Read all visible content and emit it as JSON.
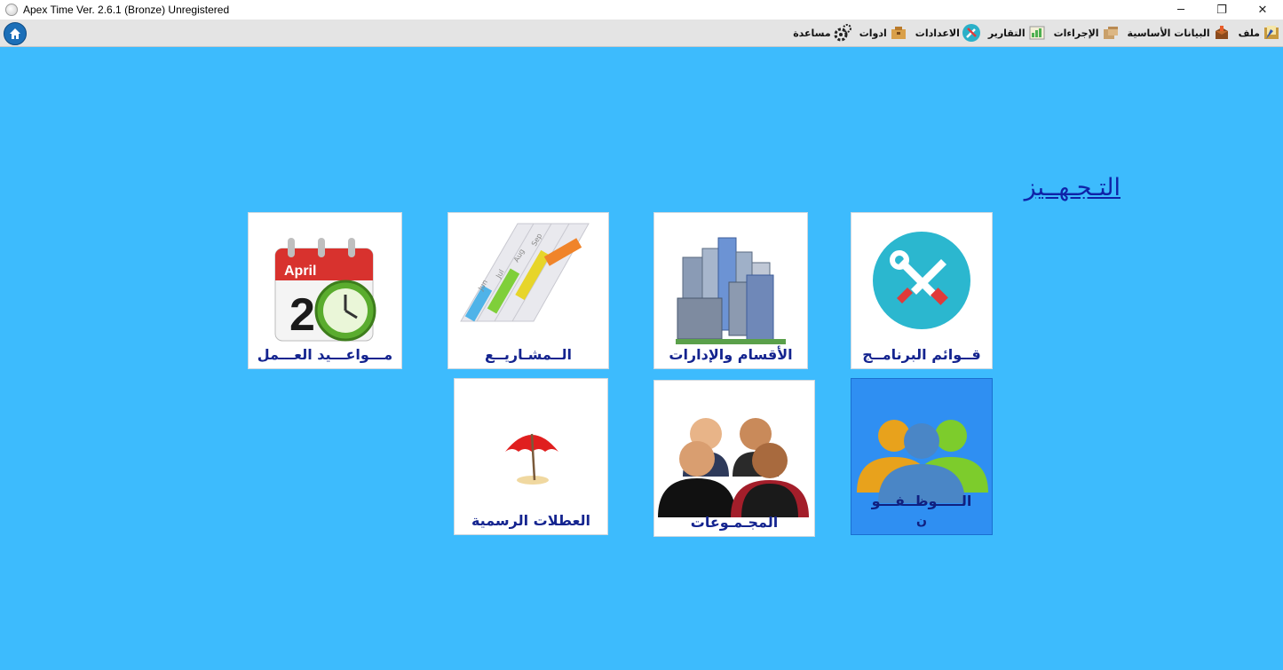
{
  "window": {
    "title": "Apex Time Ver. 2.6.1 (Bronze) Unregistered",
    "minimize": "─",
    "restore": "❐",
    "close": "✕"
  },
  "menu": {
    "items": [
      {
        "label": "ملف",
        "icon": "file-icon"
      },
      {
        "label": "البيانات الأساسية",
        "icon": "basic-data-icon"
      },
      {
        "label": "الإجراءات",
        "icon": "procedures-icon"
      },
      {
        "label": "التقارير",
        "icon": "reports-icon"
      },
      {
        "label": "الاعدادات",
        "icon": "settings-icon"
      },
      {
        "label": "ادوات",
        "icon": "tools-icon"
      },
      {
        "label": "مساعدة",
        "icon": "help-icon"
      }
    ]
  },
  "section": {
    "title": "التـجـهــيز"
  },
  "tiles": {
    "program_lists": "قــوائم البرنامــج",
    "departments": "الأقسام والإدارات",
    "projects": "الــمشـاريــع",
    "work_schedules": "مـــواعـــيد العـــمل",
    "employees_line1": "الـــــوظــفـــو",
    "employees_line2": "ن",
    "groups": "المجـمـوعات",
    "holidays": "العطلات الرسمية",
    "calendar_month": "April",
    "calendar_day": "20",
    "gantt_months": [
      "Jun",
      "Jul",
      "Aug",
      "Sep"
    ]
  },
  "colors": {
    "background": "#3dbbfd",
    "label": "#14248f",
    "selected_tile": "#2f8ff2"
  }
}
